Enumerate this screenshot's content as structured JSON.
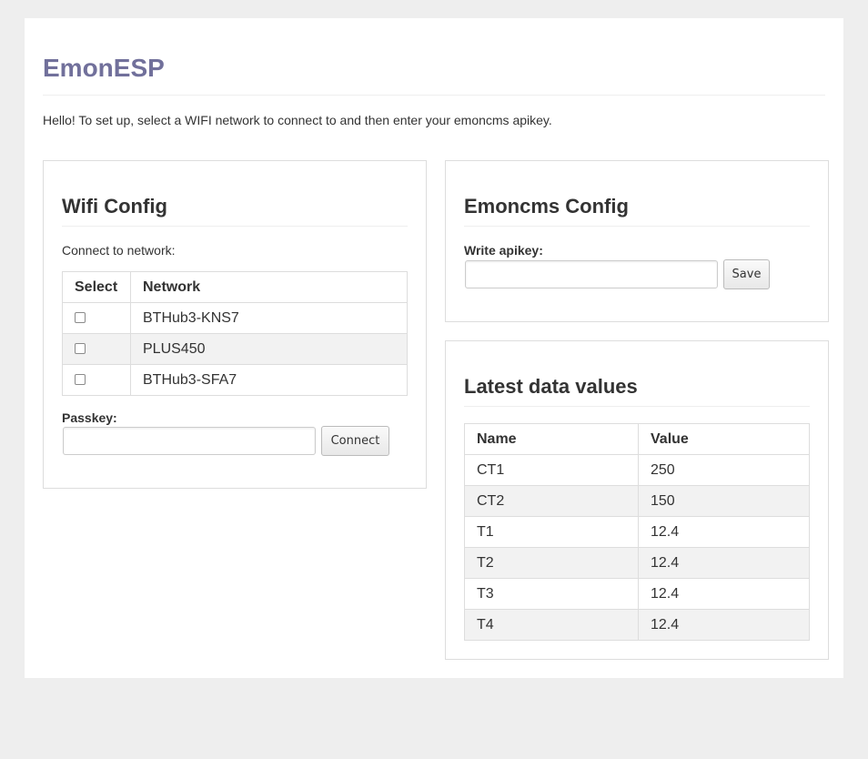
{
  "app": {
    "title": "EmonESP",
    "intro": "Hello! To set up, select a WIFI network to connect to and then enter your emoncms apikey."
  },
  "wifi": {
    "heading": "Wifi Config",
    "connect_label": "Connect to network:",
    "columns": [
      "Select",
      "Network"
    ],
    "networks": [
      {
        "name": "BTHub3-KNS7",
        "selected": false
      },
      {
        "name": "PLUS450",
        "selected": false
      },
      {
        "name": "BTHub3-SFA7",
        "selected": false
      }
    ],
    "passkey_label": "Passkey:",
    "passkey_value": "",
    "connect_button": "Connect"
  },
  "emoncms": {
    "heading": "Emoncms Config",
    "apikey_label": "Write apikey:",
    "apikey_value": "",
    "save_button": "Save"
  },
  "data_values": {
    "heading": "Latest data values",
    "columns": [
      "Name",
      "Value"
    ],
    "rows": [
      {
        "name": "CT1",
        "value": "250"
      },
      {
        "name": "CT2",
        "value": "150"
      },
      {
        "name": "T1",
        "value": "12.4"
      },
      {
        "name": "T2",
        "value": "12.4"
      },
      {
        "name": "T3",
        "value": "12.4"
      },
      {
        "name": "T4",
        "value": "12.4"
      }
    ]
  },
  "colors": {
    "title": "#71709b",
    "background": "#eeeeee",
    "stripe": "#f2f2f2"
  }
}
